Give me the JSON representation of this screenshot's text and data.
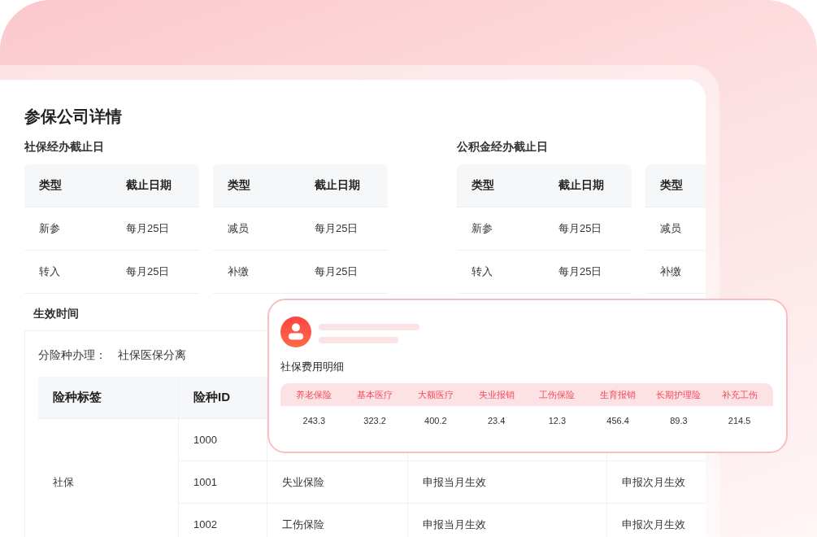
{
  "page": {
    "title": "参保公司详情"
  },
  "deadline_sections": [
    {
      "title": "社保经办截止日",
      "tables": [
        {
          "columns": [
            "类型",
            "截止日期"
          ],
          "rows": [
            [
              "新参",
              "每月25日"
            ],
            [
              "转入",
              "每月25日"
            ]
          ]
        },
        {
          "columns": [
            "类型",
            "截止日期"
          ],
          "rows": [
            [
              "减员",
              "每月25日"
            ],
            [
              "补缴",
              "每月25日"
            ]
          ]
        }
      ]
    },
    {
      "title": "公积金经办截止日",
      "tables": [
        {
          "columns": [
            "类型",
            "截止日期"
          ],
          "rows": [
            [
              "新参",
              "每月25日"
            ],
            [
              "转入",
              "每月25日"
            ]
          ]
        },
        {
          "columns": [
            "类型"
          ],
          "rows": [
            [
              "减员"
            ],
            [
              "补缴"
            ]
          ]
        }
      ]
    }
  ],
  "effective": {
    "title": "生效时间",
    "mode_label": "分险种办理：",
    "mode_value": "社保医保分离",
    "table": {
      "columns": [
        "险种标签",
        "险种ID"
      ],
      "rows": [
        [
          "",
          "1000"
        ],
        [
          "社保",
          "1001",
          "失业保险",
          "申报当月生效",
          "申报次月生效"
        ],
        [
          "",
          "1002",
          "工伤保险",
          "申报当月生效",
          "申报次月生效"
        ]
      ]
    }
  },
  "popup": {
    "title": "社保费用明细",
    "columns": [
      "养老保险",
      "基本医疗",
      "大额医疗",
      "失业报销",
      "工伤保险",
      "生育报销",
      "长期护理险",
      "补充工伤"
    ],
    "values": [
      "243.3",
      "323.2",
      "400.2",
      "23.4",
      "12.3",
      "456.4",
      "89.3",
      "214.5"
    ]
  }
}
